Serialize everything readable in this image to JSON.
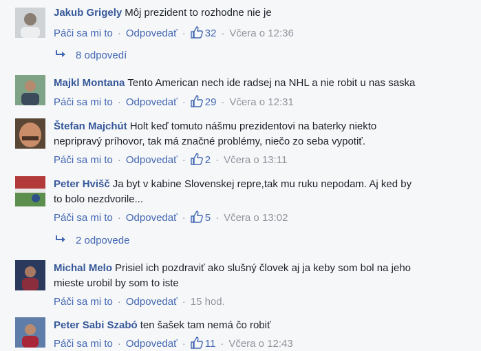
{
  "action_like": "Páči sa mi to",
  "action_reply": "Odpovedať",
  "separator": "·",
  "comments": [
    {
      "author": "Jakub Grigely",
      "text": "Môj prezident to rozhodne nie je",
      "likes": "32",
      "time": "Včera o 12:36",
      "replies": "8 odpovedí"
    },
    {
      "author": "Majkl Montana",
      "text": "Tento American nech ide radsej na NHL a nie robit u nas saska",
      "likes": "29",
      "time": "Včera o 12:31"
    },
    {
      "author": "Štefan Majchút",
      "text_line1": "Holt keď tomuto nášmu prezidentovi na baterky niekto",
      "text_line2": "nepripravý príhovor, tak má značné problémy, niečo zo seba vypotiť.",
      "likes": "2",
      "time": "Včera o 13:11"
    },
    {
      "author": "Peter Hvišč",
      "text_line1": "Ja byt v kabine Slovenskej repre,tak mu ruku nepodam. Aj ked by",
      "text_line2": "to bolo nezdvorile...",
      "likes": "5",
      "time": "Včera o 13:02",
      "replies": "2 odpovede"
    },
    {
      "author": "Michal Melo",
      "text_line1": "Prisiel ich pozdraviť ako slušný človek aj ja keby som bol na jeho",
      "text_line2": "mieste urobil by som to iste",
      "time": "15 hod."
    },
    {
      "author": "Peter Sabi Szabó",
      "text": "ten šašek tam nemá čo robiť",
      "likes": "11",
      "time": "Včera o 12:43"
    }
  ],
  "colors": {
    "name": "#365899",
    "link": "#4267b2",
    "meta": "#90949c",
    "background": "#f6f7f9"
  }
}
